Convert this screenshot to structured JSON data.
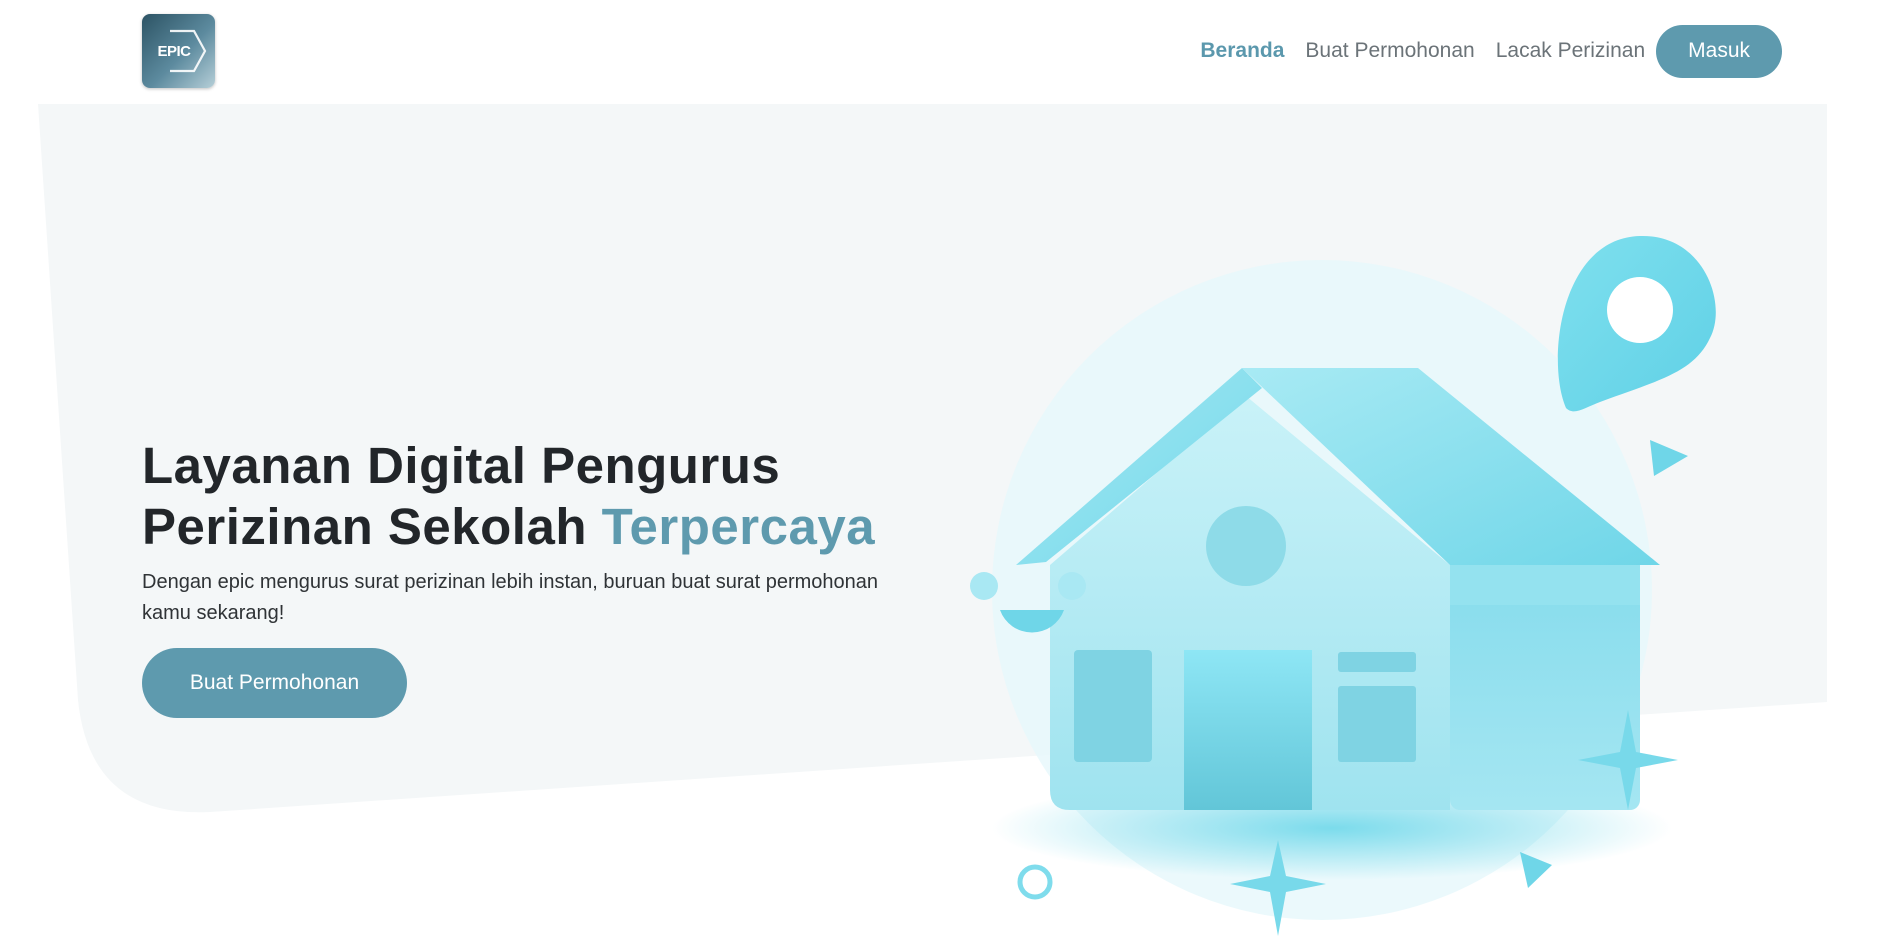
{
  "brand": {
    "logo_text": "EPIC",
    "primary_color": "#5e9aae",
    "hero_bg_color": "#f4f7f8"
  },
  "nav": {
    "links": [
      {
        "label": "Beranda",
        "active": true
      },
      {
        "label": "Buat Permohonan",
        "active": false
      },
      {
        "label": "Lacak Perizinan",
        "active": false
      }
    ],
    "login_label": "Masuk"
  },
  "hero": {
    "title_line1": "Layanan Digital Pengurus",
    "title_line2": "Perizinan Sekolah",
    "title_accent": "Terpercaya",
    "subtitle": "Dengan epic mengurus surat perizinan lebih instan, buruan buat surat permohonan kamu sekarang!",
    "cta_label": "Buat Permohonan"
  },
  "illustration": {
    "icons": [
      "house-icon",
      "location-pin-icon",
      "sparkle-icon",
      "triangle-icon",
      "ring-icon",
      "smile-icon"
    ]
  }
}
